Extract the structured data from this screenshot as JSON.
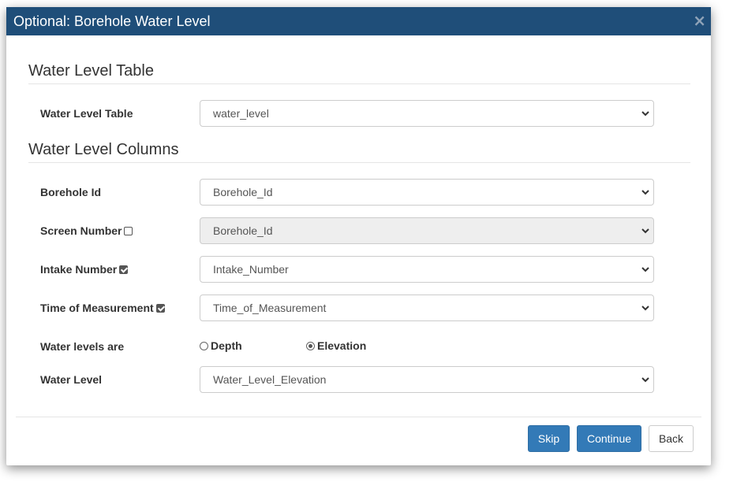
{
  "dialog": {
    "title": "Optional: Borehole Water Level",
    "close_symbol": "×"
  },
  "sections": {
    "table_heading": "Water Level Table",
    "columns_heading": "Water Level Columns"
  },
  "fields": {
    "water_level_table": {
      "label": "Water Level Table",
      "value": "water_level"
    },
    "borehole_id": {
      "label": "Borehole Id",
      "value": "Borehole_Id"
    },
    "screen_number": {
      "label": "Screen Number",
      "value": "Borehole_Id",
      "checked": false,
      "disabled": true
    },
    "intake_number": {
      "label": "Intake Number",
      "value": "Intake_Number",
      "checked": true
    },
    "time_of_measurement": {
      "label": "Time of Measurement",
      "value": "Time_of_Measurement",
      "checked": true
    },
    "water_levels_are": {
      "label": "Water levels are",
      "options": [
        "Depth",
        "Elevation"
      ],
      "selected": "Elevation"
    },
    "water_level": {
      "label": "Water Level",
      "value": "Water_Level_Elevation"
    }
  },
  "buttons": {
    "skip": "Skip",
    "continue": "Continue",
    "back": "Back"
  },
  "colors": {
    "header_bg": "#1f4e79",
    "primary": "#337ab7"
  },
  "icons": {
    "close": "close-icon",
    "dropdown": "chevron-down-icon"
  }
}
